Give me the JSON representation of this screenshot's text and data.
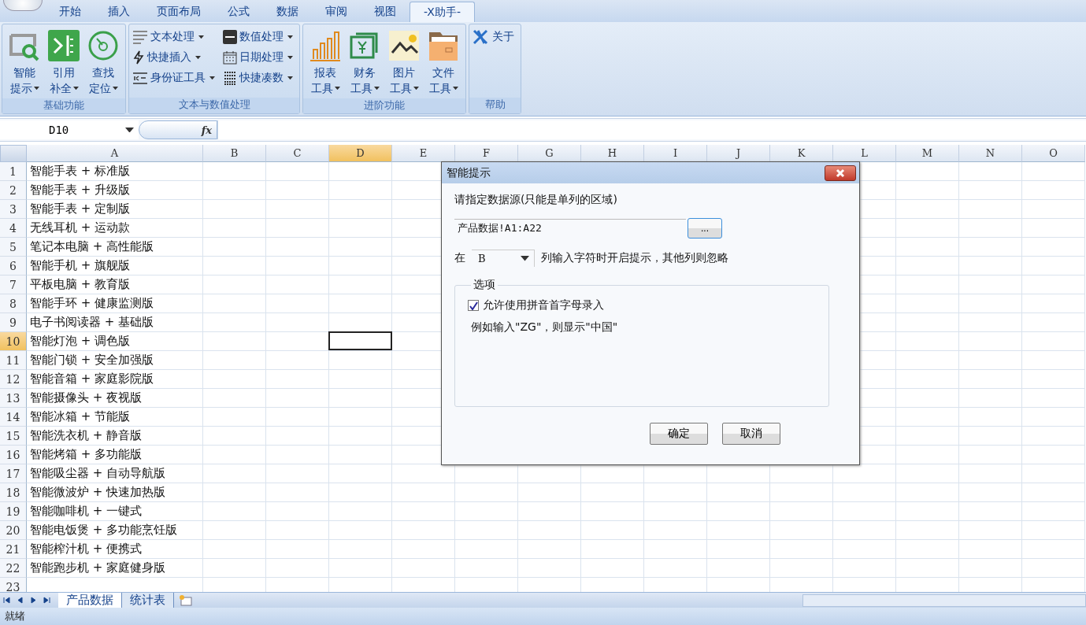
{
  "ribbon_tabs": [
    {
      "label": "开始",
      "selected": false
    },
    {
      "label": "插入",
      "selected": false
    },
    {
      "label": "页面布局",
      "selected": false
    },
    {
      "label": "公式",
      "selected": false
    },
    {
      "label": "数据",
      "selected": false
    },
    {
      "label": "审阅",
      "selected": false
    },
    {
      "label": "视图",
      "selected": false
    },
    {
      "label": "-X助手-",
      "selected": true
    }
  ],
  "ribbon_groups": [
    {
      "label": "基础功能",
      "items": [
        {
          "kind": "large",
          "lines": [
            "智能",
            "提示"
          ],
          "dropdown": true
        },
        {
          "kind": "large",
          "lines": [
            "引用",
            "补全"
          ],
          "dropdown": true
        },
        {
          "kind": "large",
          "lines": [
            "查找",
            "定位"
          ],
          "dropdown": true
        }
      ]
    },
    {
      "label": "文本与数值处理",
      "items": [
        {
          "kind": "small",
          "label": "文本处理",
          "dropdown": true
        },
        {
          "kind": "small",
          "label": "数值处理",
          "dropdown": true
        },
        {
          "kind": "small",
          "label": "快捷插入",
          "dropdown": true
        },
        {
          "kind": "small",
          "label": "日期处理",
          "dropdown": true
        },
        {
          "kind": "small",
          "label": "身份证工具",
          "dropdown": true
        },
        {
          "kind": "small",
          "label": "快捷凑数",
          "dropdown": true
        }
      ]
    },
    {
      "label": "进阶功能",
      "items": [
        {
          "kind": "large",
          "lines": [
            "报表",
            "工具"
          ],
          "dropdown": true
        },
        {
          "kind": "large",
          "lines": [
            "财务",
            "工具"
          ],
          "dropdown": true
        },
        {
          "kind": "large",
          "lines": [
            "图片",
            "工具"
          ],
          "dropdown": true
        },
        {
          "kind": "large",
          "lines": [
            "文件",
            "工具"
          ],
          "dropdown": true
        }
      ]
    },
    {
      "label": "帮助",
      "items": [
        {
          "kind": "small",
          "label": "关于",
          "dropdown": false
        }
      ]
    }
  ],
  "name_box": "D10",
  "formula_label": "fx",
  "columns": [
    {
      "label": "A",
      "selected": false
    },
    {
      "label": "B",
      "selected": false
    },
    {
      "label": "C",
      "selected": false
    },
    {
      "label": "D",
      "selected": true
    },
    {
      "label": "E",
      "selected": false
    },
    {
      "label": "F",
      "selected": false
    },
    {
      "label": "G",
      "selected": false
    },
    {
      "label": "H",
      "selected": false
    },
    {
      "label": "I",
      "selected": false
    },
    {
      "label": "J",
      "selected": false
    },
    {
      "label": "K",
      "selected": false
    },
    {
      "label": "L",
      "selected": false
    },
    {
      "label": "M",
      "selected": false
    },
    {
      "label": "N",
      "selected": false
    },
    {
      "label": "O",
      "selected": false
    }
  ],
  "rows": [
    {
      "number": "1",
      "selected": false,
      "value": "智能手表 + 标准版"
    },
    {
      "number": "2",
      "selected": false,
      "value": "智能手表 + 升级版"
    },
    {
      "number": "3",
      "selected": false,
      "value": "智能手表 + 定制版"
    },
    {
      "number": "4",
      "selected": false,
      "value": "无线耳机 + 运动款"
    },
    {
      "number": "5",
      "selected": false,
      "value": "笔记本电脑 + 高性能版"
    },
    {
      "number": "6",
      "selected": false,
      "value": "智能手机 + 旗舰版"
    },
    {
      "number": "7",
      "selected": false,
      "value": "平板电脑 + 教育版"
    },
    {
      "number": "8",
      "selected": false,
      "value": "智能手环 + 健康监测版"
    },
    {
      "number": "9",
      "selected": false,
      "value": "电子书阅读器 + 基础版"
    },
    {
      "number": "10",
      "selected": true,
      "value": "智能灯泡 + 调色版"
    },
    {
      "number": "11",
      "selected": false,
      "value": "智能门锁 + 安全加强版"
    },
    {
      "number": "12",
      "selected": false,
      "value": "智能音箱 + 家庭影院版"
    },
    {
      "number": "13",
      "selected": false,
      "value": "智能摄像头 + 夜视版"
    },
    {
      "number": "14",
      "selected": false,
      "value": "智能冰箱 + 节能版"
    },
    {
      "number": "15",
      "selected": false,
      "value": "智能洗衣机 + 静音版"
    },
    {
      "number": "16",
      "selected": false,
      "value": "智能烤箱 + 多功能版"
    },
    {
      "number": "17",
      "selected": false,
      "value": "智能吸尘器 + 自动导航版"
    },
    {
      "number": "18",
      "selected": false,
      "value": "智能微波炉 + 快速加热版"
    },
    {
      "number": "19",
      "selected": false,
      "value": "智能咖啡机 + 一键式"
    },
    {
      "number": "20",
      "selected": false,
      "value": "智能电饭煲 + 多功能烹饪版"
    },
    {
      "number": "21",
      "selected": false,
      "value": "智能榨汁机 + 便携式"
    },
    {
      "number": "22",
      "selected": false,
      "value": "智能跑步机 + 家庭健身版"
    },
    {
      "number": "23",
      "selected": false
    }
  ],
  "sheet_tabs": [
    {
      "label": "产品数据",
      "selected": true
    },
    {
      "label": "统计表",
      "selected": false
    }
  ],
  "status_bar": "就绪",
  "dialog": {
    "title": "智能提示",
    "prompt": "请指定数据源(只能是单列的区域)",
    "range_value": "产品数据!A1:A22",
    "browse_button": "...",
    "column_prefix": "在",
    "column_value": "B",
    "column_suffix": "列输入字符时开启提示，其他列则忽略",
    "options_title": "选项",
    "pinyin_option": {
      "label": "允许使用拼音首字母录入",
      "checked": true
    },
    "example": "例如输入\"ZG\"，则显示\"中国\"",
    "buttons": [
      "确定",
      "取消"
    ]
  }
}
